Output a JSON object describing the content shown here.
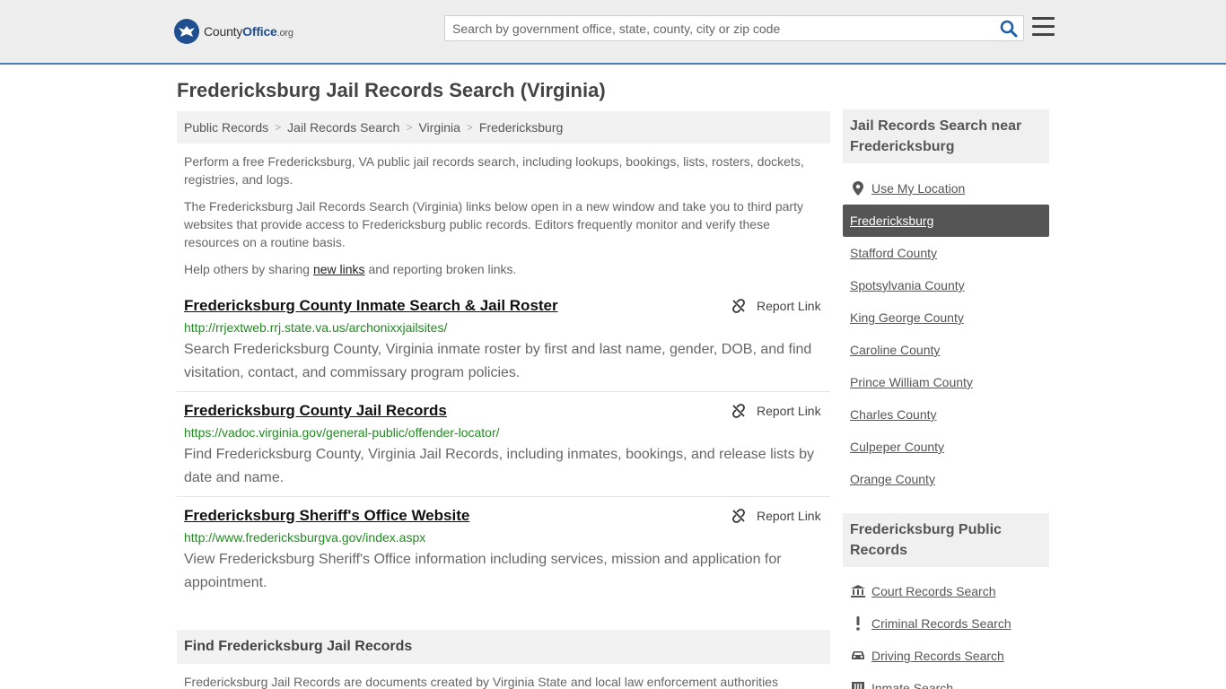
{
  "header": {
    "logo_main": "County",
    "logo_bold": "Office",
    "logo_org": ".org",
    "search_placeholder": "Search by government office, state, county, city or zip code"
  },
  "page": {
    "title": "Fredericksburg Jail Records Search (Virginia)",
    "breadcrumb": [
      "Public Records",
      "Jail Records Search",
      "Virginia",
      "Fredericksburg"
    ],
    "intro1": "Perform a free Fredericksburg, VA public jail records search, including lookups, bookings, lists, rosters, dockets, registries, and logs.",
    "intro2": "The Fredericksburg Jail Records Search (Virginia) links below open in a new window and take you to third party websites that provide access to Fredericksburg public records. Editors frequently monitor and verify these resources on a routine basis.",
    "help_prefix": "Help others by sharing ",
    "help_link": "new links",
    "help_suffix": " and reporting broken links.",
    "report_label": "Report Link"
  },
  "results": [
    {
      "title": "Fredericksburg County Inmate Search & Jail Roster",
      "url": "http://rrjextweb.rrj.state.va.us/archonixxjailsites/",
      "desc": "Search Fredericksburg County, Virginia inmate roster by first and last name, gender, DOB, and find visitation, contact, and commissary program policies."
    },
    {
      "title": "Fredericksburg County Jail Records",
      "url": "https://vadoc.virginia.gov/general-public/offender-locator/",
      "desc": "Find Fredericksburg County, Virginia Jail Records, including inmates, bookings, and release lists by date and name."
    },
    {
      "title": "Fredericksburg Sheriff's Office Website",
      "url": "http://www.fredericksburgva.gov/index.aspx",
      "desc": "View Fredericksburg Sheriff's Office information including services, mission and application for appointment."
    }
  ],
  "find_section": {
    "title": "Find Fredericksburg Jail Records",
    "text": "Fredericksburg Jail Records are documents created by Virginia State and local law enforcement authorities"
  },
  "sidebar": {
    "nearby_title": "Jail Records Search near Fredericksburg",
    "use_location": "Use My Location",
    "nearby": [
      "Fredericksburg",
      "Stafford County",
      "Spotsylvania County",
      "King George County",
      "Caroline County",
      "Prince William County",
      "Charles County",
      "Culpeper County",
      "Orange County"
    ],
    "public_title": "Fredericksburg Public Records",
    "public_records": [
      {
        "label": "Court Records Search",
        "icon": "courthouse-icon"
      },
      {
        "label": "Criminal Records Search",
        "icon": "exclamation-icon"
      },
      {
        "label": "Driving Records Search",
        "icon": "car-icon"
      },
      {
        "label": "Inmate Search",
        "icon": "jail-icon"
      }
    ]
  }
}
